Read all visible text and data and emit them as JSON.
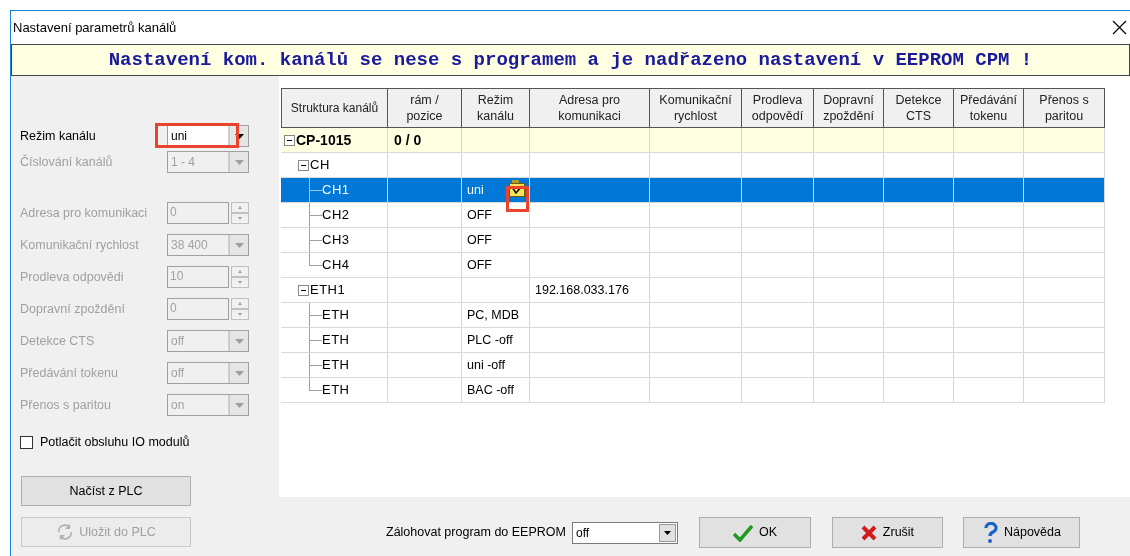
{
  "window": {
    "title": "Nastavení parametrů kanálů"
  },
  "banner": "Nastavení kom. kanálů se nese s programem a je nadřazeno nastavení v EEPROM CPM !",
  "channel_settings": [
    {
      "kind": "combo",
      "label": "Režim kanálu",
      "value": "uni",
      "disabled": false,
      "highlighted": true
    },
    {
      "kind": "combo",
      "label": "Číslování kanálů",
      "value": "1 - 4",
      "disabled": true,
      "highlighted": false
    }
  ],
  "communication_settings": [
    {
      "kind": "spin",
      "label": "Adresa pro komunikaci",
      "value": "0",
      "disabled": true
    },
    {
      "kind": "combo",
      "label": "Komunikační rychlost",
      "value": "38 400",
      "disabled": true
    },
    {
      "kind": "spin",
      "label": "Prodleva odpovědi",
      "value": "10",
      "disabled": true
    },
    {
      "kind": "spin",
      "label": "Dopravní zpoždění",
      "value": "0",
      "disabled": true
    },
    {
      "kind": "combo",
      "label": "Detekce CTS",
      "value": "off",
      "disabled": true
    },
    {
      "kind": "combo",
      "label": "Předávání tokenu",
      "value": "off",
      "disabled": true
    },
    {
      "kind": "combo",
      "label": "Přenos s paritou",
      "value": "on",
      "disabled": true
    }
  ],
  "suppress_io": {
    "label": "Potlačit obsluhu IO modulů",
    "checked": false
  },
  "plc_buttons": [
    {
      "kind": "plain",
      "label": "Načíst z PLC",
      "disabled": false
    },
    {
      "kind": "sync",
      "label": "Uložit do PLC",
      "disabled": true
    }
  ],
  "table": {
    "columns": [
      "Struktura kanálů",
      "rám /\npozice",
      "Režim\nkanálu",
      "Adresa pro\nkomunikaci",
      "Komunikační\nrychlost",
      "Prodleva\nodpovědí",
      "Dopravní\nzpoždění",
      "Detekce\nCTS",
      "Předávání\ntokenu",
      "Přenos s\nparitou"
    ],
    "rows": [
      {
        "name": "CP-1015",
        "frame_position": "0 / 0",
        "selected": false,
        "highlighted": false,
        "expanded": true,
        "children": [
          {
            "name": "CH",
            "selected": false,
            "highlighted": false,
            "expanded": true,
            "children": [
              {
                "name": "CH1",
                "mode": "uni",
                "selected": true,
                "highlighted": true
              },
              {
                "name": "CH2",
                "mode": "OFF",
                "selected": false,
                "highlighted": false
              },
              {
                "name": "CH3",
                "mode": "OFF",
                "selected": false,
                "highlighted": false
              },
              {
                "name": "CH4",
                "mode": "OFF",
                "selected": false,
                "highlighted": false
              }
            ]
          },
          {
            "name": "ETH1",
            "address": "192.168.033.176",
            "selected": false,
            "highlighted": false,
            "expanded": true,
            "children": [
              {
                "name": "ETH",
                "mode": "PC, MDB",
                "selected": false,
                "highlighted": false
              },
              {
                "name": "ETH",
                "mode": "PLC -off",
                "selected": false,
                "highlighted": false
              },
              {
                "name": "ETH",
                "mode": "uni -off",
                "selected": false,
                "highlighted": false
              },
              {
                "name": "ETH",
                "mode": "BAC -off",
                "selected": false,
                "highlighted": false
              }
            ]
          }
        ]
      }
    ]
  },
  "backup": {
    "label": "Zálohovat program do EEPROM",
    "value": "off"
  },
  "dialog_buttons": [
    {
      "kind": "ok",
      "label": "OK"
    },
    {
      "kind": "cancel",
      "label": "Zrušit"
    },
    {
      "kind": "help",
      "label": "Nápověda"
    }
  ]
}
